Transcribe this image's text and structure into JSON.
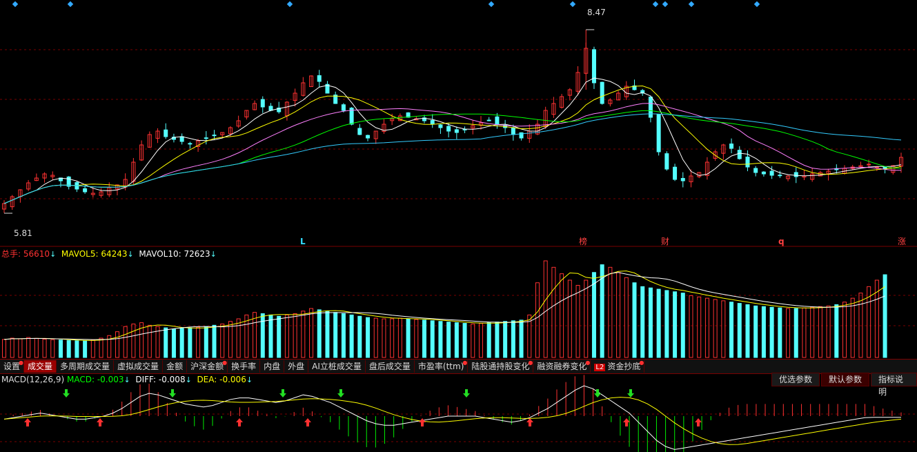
{
  "price": {
    "high_label": "8.47",
    "low_label": "5.81",
    "markers": [
      {
        "text": "L",
        "color": "#33ddff"
      },
      {
        "text": "榜",
        "color": "#ff4040"
      },
      {
        "text": "财",
        "color": "#ff4040"
      },
      {
        "text": "q",
        "color": "#ff4040"
      },
      {
        "text": "涨",
        "color": "#ff4040"
      }
    ]
  },
  "volume": {
    "total_label": "总手:",
    "total_value": "56610",
    "mavol5_label": "MAVOL5:",
    "mavol5_value": "64243",
    "mavol10_label": "MAVOL10:",
    "mavol10_value": "72623",
    "down_arrow": "↓"
  },
  "tabs": [
    {
      "label": "设置",
      "dot": true,
      "active": false
    },
    {
      "label": "成交量",
      "dot": false,
      "active": true
    },
    {
      "label": "多周期成交量",
      "dot": false,
      "active": false
    },
    {
      "label": "虚拟成交量",
      "dot": false,
      "active": false
    },
    {
      "label": "金额",
      "dot": false,
      "active": false
    },
    {
      "label": "沪深金额",
      "dot": true,
      "active": false
    },
    {
      "label": "换手率",
      "dot": false,
      "active": false
    },
    {
      "label": "内盘",
      "dot": false,
      "active": false
    },
    {
      "label": "外盘",
      "dot": false,
      "active": false
    },
    {
      "label": "AI立桩成交量",
      "dot": false,
      "active": false
    },
    {
      "label": "盘后成交量",
      "dot": false,
      "active": false
    },
    {
      "label": "市盈率(ttm)",
      "dot": true,
      "active": false
    },
    {
      "label": "陆股通持股变化",
      "dot": true,
      "active": false
    },
    {
      "label": "融资融券变化",
      "dot": true,
      "active": false
    },
    {
      "label": "资金抄底",
      "dot": true,
      "active": false,
      "badge": "L2"
    }
  ],
  "macd": {
    "title": "MACD(12,26,9)",
    "macd_label": "MACD:",
    "macd_value": "-0.003",
    "diff_label": "DIFF:",
    "diff_value": "-0.008",
    "dea_label": "DEA:",
    "dea_value": "-0.006",
    "buttons": [
      "优选参数",
      "默认参数",
      "指标说明"
    ]
  },
  "colors": {
    "up": "#ff3232",
    "down": "#54ffff",
    "ma5": "#ffffff",
    "ma10": "#ffff00",
    "ma20": "#ff80ff",
    "ma30": "#00ff00",
    "ma60": "#33ccff",
    "grid": "#7a0000"
  },
  "chart_data": {
    "type": "candlestick",
    "high": 8.47,
    "low": 5.81,
    "ylim": [
      5.6,
      8.7
    ],
    "close": [
      5.95,
      6.05,
      6.15,
      6.25,
      6.32,
      6.38,
      6.36,
      6.28,
      6.2,
      6.16,
      6.12,
      6.1,
      6.12,
      6.18,
      6.22,
      6.3,
      6.55,
      6.8,
      6.95,
      7.0,
      6.92,
      6.88,
      6.85,
      6.82,
      6.86,
      6.9,
      6.94,
      6.98,
      7.05,
      7.15,
      7.3,
      7.4,
      7.35,
      7.3,
      7.28,
      7.42,
      7.55,
      7.7,
      7.8,
      7.72,
      7.55,
      7.4,
      7.3,
      7.1,
      6.95,
      6.9,
      7.0,
      7.1,
      7.18,
      7.22,
      7.2,
      7.18,
      7.15,
      7.1,
      7.05,
      7.0,
      6.98,
      7.02,
      7.08,
      7.12,
      7.15,
      7.1,
      7.05,
      6.95,
      6.9,
      7.0,
      7.1,
      7.3,
      7.4,
      7.5,
      7.6,
      7.85,
      8.2,
      7.7,
      7.4,
      7.45,
      7.55,
      7.65,
      7.6,
      7.55,
      7.2,
      6.7,
      6.45,
      6.3,
      6.28,
      6.35,
      6.4,
      6.55,
      6.7,
      6.8,
      6.75,
      6.6,
      6.48,
      6.4,
      6.38,
      6.36,
      6.36,
      6.35,
      6.34,
      6.35,
      6.38,
      6.4,
      6.42,
      6.44,
      6.46,
      6.48,
      6.5,
      6.52,
      6.48,
      6.45,
      6.5,
      6.62
    ],
    "volume": [
      14000,
      15000,
      14500,
      15500,
      14800,
      14200,
      13800,
      13500,
      13200,
      13000,
      12800,
      13500,
      15000,
      17000,
      20000,
      24000,
      26000,
      27000,
      25000,
      24000,
      23000,
      22000,
      22500,
      23000,
      23500,
      24000,
      25000,
      26000,
      28000,
      30000,
      33000,
      35000,
      34000,
      33000,
      32000,
      33000,
      34000,
      36000,
      38000,
      37000,
      36000,
      35000,
      34000,
      33000,
      32000,
      31000,
      30500,
      30000,
      30000,
      30500,
      30000,
      29500,
      29000,
      28500,
      28000,
      27500,
      27000,
      26500,
      26000,
      26500,
      27000,
      27500,
      28000,
      28500,
      29000,
      33000,
      58000,
      75000,
      70000,
      65000,
      60000,
      56000,
      60000,
      66000,
      72000,
      70000,
      66000,
      62000,
      58000,
      55000,
      54000,
      53000,
      52000,
      51000,
      50000,
      48000,
      47000,
      46000,
      45000,
      44000,
      43000,
      42000,
      41000,
      40000,
      39500,
      39000,
      38500,
      38000,
      38000,
      38500,
      39000,
      39500,
      40000,
      41000,
      43000,
      46000,
      50000,
      55000,
      60000,
      64243
    ],
    "macd_diff": [
      -0.02,
      -0.01,
      0.0,
      0.01,
      0.02,
      0.01,
      0.0,
      -0.01,
      -0.02,
      -0.02,
      -0.01,
      0.0,
      0.02,
      0.05,
      0.09,
      0.13,
      0.15,
      0.14,
      0.12,
      0.1,
      0.08,
      0.07,
      0.06,
      0.07,
      0.09,
      0.11,
      0.12,
      0.12,
      0.11,
      0.1,
      0.09,
      0.1,
      0.12,
      0.14,
      0.13,
      0.11,
      0.09,
      0.06,
      0.03,
      0.0,
      -0.03,
      -0.05,
      -0.06,
      -0.06,
      -0.05,
      -0.04,
      -0.03,
      -0.02,
      -0.01,
      0.0,
      0.0,
      0.0,
      0.0,
      -0.01,
      -0.02,
      -0.03,
      -0.04,
      -0.03,
      -0.01,
      0.02,
      0.05,
      0.09,
      0.13,
      0.17,
      0.2,
      0.18,
      0.14,
      0.1,
      0.06,
      0.02,
      -0.04,
      -0.1,
      -0.16,
      -0.2,
      -0.22,
      -0.21,
      -0.2,
      -0.19,
      -0.18,
      -0.17,
      -0.16,
      -0.15,
      -0.14,
      -0.13,
      -0.12,
      -0.11,
      -0.1,
      -0.09,
      -0.08,
      -0.07,
      -0.06,
      -0.05,
      -0.04,
      -0.03,
      -0.02,
      -0.01,
      -0.008,
      -0.008,
      -0.008,
      -0.008
    ]
  }
}
